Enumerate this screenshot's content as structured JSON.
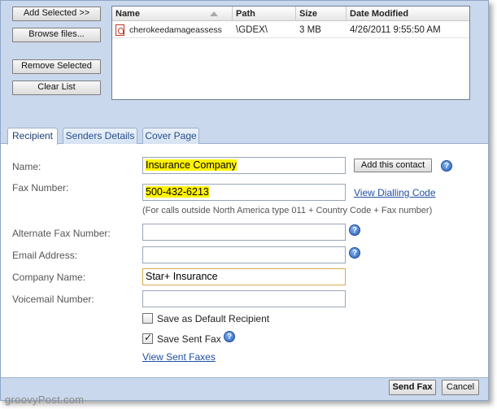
{
  "file_buttons": {
    "add_selected": "Add Selected >>",
    "browse": "Browse files...",
    "remove_selected": "Remove Selected",
    "clear_list": "Clear List"
  },
  "file_list": {
    "columns": [
      "Name",
      "Path",
      "Size",
      "Date Modified"
    ],
    "rows": [
      {
        "name": "cherokeedamageassess",
        "path": "\\GDEX\\",
        "size": "3 MB",
        "date_modified": "4/26/2011 9:55:50 AM"
      }
    ]
  },
  "tabs": [
    "Recipient",
    "Senders Details",
    "Cover Page"
  ],
  "active_tab": "Recipient",
  "form": {
    "name_label": "Name:",
    "name_value": "Insurance Company",
    "add_contact_label": "Add this contact",
    "fax_label": "Fax Number:",
    "fax_value": "500-432-6213",
    "dialling_code_link": "View Dialling Code",
    "fax_note": "(For calls outside North America type 011 + Country Code + Fax number)",
    "alt_fax_label": "Alternate Fax Number:",
    "alt_fax_value": "",
    "email_label": "Email Address:",
    "email_value": "",
    "company_label": "Company Name:",
    "company_value": "Star+ Insurance",
    "voicemail_label": "Voicemail Number:",
    "voicemail_value": "",
    "save_default_label": "Save as Default Recipient",
    "save_default_checked": false,
    "save_sent_label": "Save Sent Fax",
    "save_sent_checked": true,
    "view_sent_link": "View Sent Faxes",
    "help_glyph": "?"
  },
  "footer": {
    "send_fax": "Send Fax",
    "cancel": "Cancel"
  },
  "watermark": "groovyPost.com"
}
